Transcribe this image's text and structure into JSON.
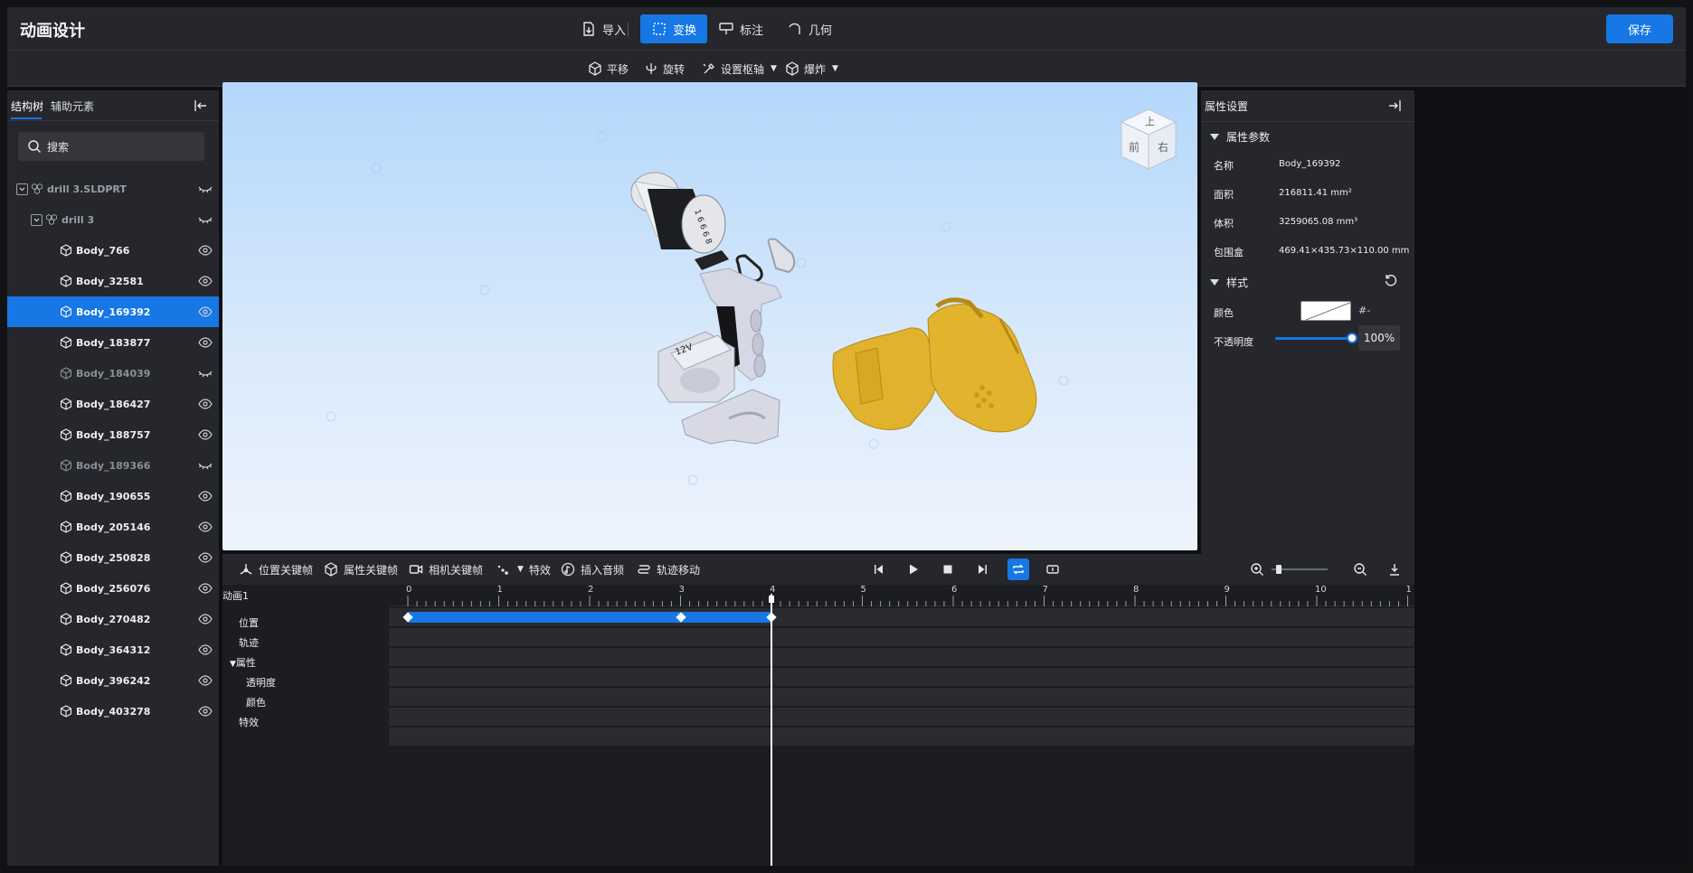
{
  "header": {
    "title": "动画设计",
    "menus": [
      {
        "label": "导入",
        "active": false
      },
      {
        "label": "变换",
        "active": true
      },
      {
        "label": "标注",
        "active": false
      },
      {
        "label": "几何",
        "active": false
      }
    ],
    "save_label": "保存"
  },
  "toolbar": {
    "items": [
      {
        "label": "平移"
      },
      {
        "label": "旋转"
      },
      {
        "label": "设置枢轴"
      },
      {
        "label": "爆炸"
      }
    ]
  },
  "left_panel": {
    "tabs": [
      "结构树",
      "辅助元素"
    ],
    "search_placeholder": "搜索",
    "tree": [
      {
        "label": "drill 3.SLDPRT",
        "level": 0,
        "expandable": true,
        "visible": false,
        "selected": false,
        "dim": false
      },
      {
        "label": "drill 3",
        "level": 1,
        "expandable": true,
        "visible": false,
        "selected": false,
        "dim": false
      },
      {
        "label": "Body_766",
        "level": 2,
        "visible": true,
        "selected": false,
        "dim": false
      },
      {
        "label": "Body_32581",
        "level": 2,
        "visible": true,
        "selected": false,
        "dim": false
      },
      {
        "label": "Body_169392",
        "level": 2,
        "visible": true,
        "selected": true,
        "dim": false
      },
      {
        "label": "Body_183877",
        "level": 2,
        "visible": true,
        "selected": false,
        "dim": false
      },
      {
        "label": "Body_184039",
        "level": 2,
        "visible": false,
        "selected": false,
        "dim": true
      },
      {
        "label": "Body_186427",
        "level": 2,
        "visible": true,
        "selected": false,
        "dim": false
      },
      {
        "label": "Body_188757",
        "level": 2,
        "visible": true,
        "selected": false,
        "dim": false
      },
      {
        "label": "Body_189366",
        "level": 2,
        "visible": false,
        "selected": false,
        "dim": true
      },
      {
        "label": "Body_190655",
        "level": 2,
        "visible": true,
        "selected": false,
        "dim": false
      },
      {
        "label": "Body_205146",
        "level": 2,
        "visible": true,
        "selected": false,
        "dim": false
      },
      {
        "label": "Body_250828",
        "level": 2,
        "visible": true,
        "selected": false,
        "dim": false
      },
      {
        "label": "Body_256076",
        "level": 2,
        "visible": true,
        "selected": false,
        "dim": false
      },
      {
        "label": "Body_270482",
        "level": 2,
        "visible": true,
        "selected": false,
        "dim": false
      },
      {
        "label": "Body_364312",
        "level": 2,
        "visible": true,
        "selected": false,
        "dim": false
      },
      {
        "label": "Body_396242",
        "level": 2,
        "visible": true,
        "selected": false,
        "dim": false
      },
      {
        "label": "Body_403278",
        "level": 2,
        "visible": true,
        "selected": false,
        "dim": false
      }
    ]
  },
  "viewport": {
    "view_cube": {
      "top": "上",
      "front": "前",
      "right": "右"
    },
    "battery_label": "12V"
  },
  "right_panel": {
    "title": "属性设置",
    "params_title": "属性参数",
    "params": [
      {
        "key": "名称",
        "value": "Body_169392"
      },
      {
        "key": "面积",
        "value": "216811.41 mm²"
      },
      {
        "key": "体积",
        "value": "3259065.08 mm³"
      },
      {
        "key": "包围盒",
        "value": "469.41×435.73×110.00 mm"
      }
    ],
    "style_title": "样式",
    "color_label": "颜色",
    "color_value": "#-",
    "opacity_label": "不透明度",
    "opacity_value": "100%",
    "opacity_fraction": 1.0
  },
  "timeline_toolbar": {
    "items": [
      {
        "label": "位置关键帧"
      },
      {
        "label": "属性关键帧"
      },
      {
        "label": "相机关键帧"
      },
      {
        "label": "特效"
      },
      {
        "label": "插入音频"
      },
      {
        "label": "轨迹移动"
      }
    ]
  },
  "timeline": {
    "animation_name": "动画1",
    "tracks": [
      "位置",
      "轨迹",
      "属性",
      "透明度",
      "颜色",
      "特效"
    ],
    "ruler_labels": [
      "0",
      "1",
      "2",
      "3",
      "4",
      "5",
      "6",
      "7",
      "8",
      "9",
      "10",
      "1"
    ],
    "position_keyframes": [
      0,
      3,
      4
    ],
    "playhead_time": 4
  },
  "colors": {
    "accent": "#1677e5",
    "panel": "#26272c",
    "model_yellow": "#e0b32c",
    "model_gray": "#d4d6e4"
  }
}
